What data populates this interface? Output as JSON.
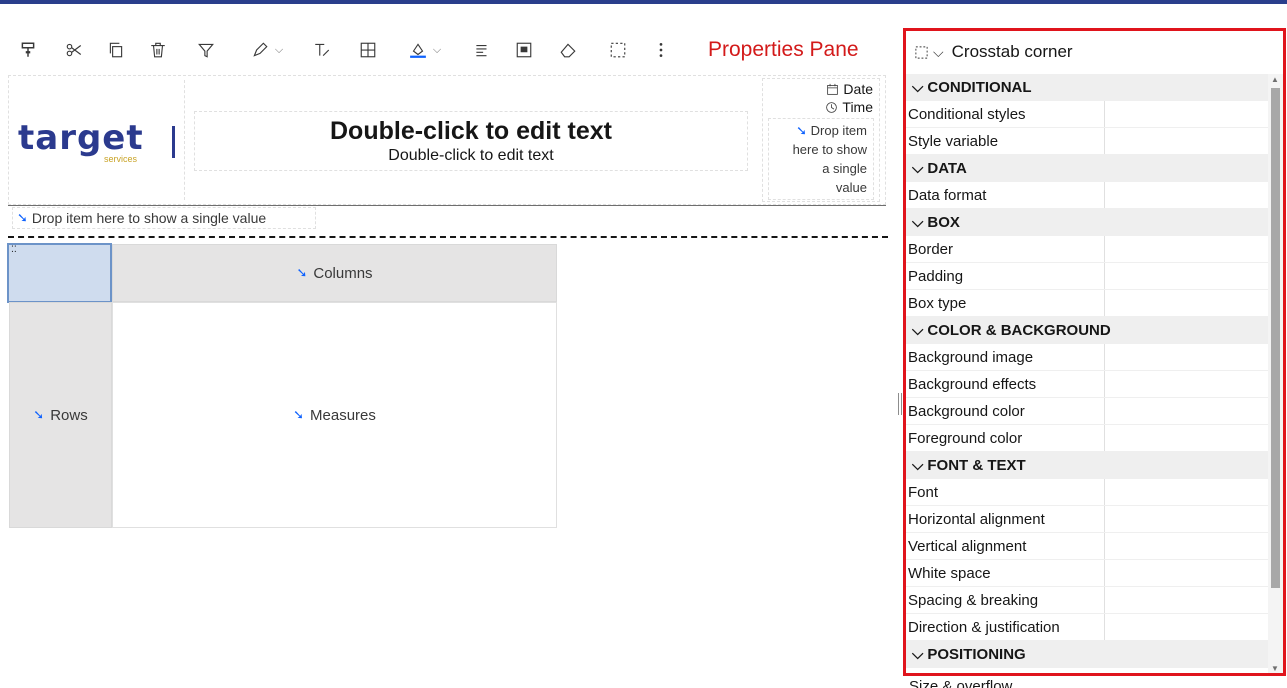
{
  "callout": {
    "label": "Properties Pane"
  },
  "toolbar": {
    "items": [
      "paint-format-icon",
      "cut-icon",
      "copy-icon",
      "delete-icon",
      "filter-icon",
      "pen-icon",
      "clear-format-icon",
      "table-icon",
      "fill-color-icon",
      "list-icon",
      "frame-icon",
      "eraser-icon",
      "select-icon",
      "more-icon"
    ]
  },
  "header": {
    "logo_text": "target",
    "logo_sub": "services",
    "title": "Double-click to edit text",
    "subtitle": "Double-click to edit text",
    "date_label": "Date",
    "time_label": "Time",
    "drop_right": [
      "Drop item",
      "here to show",
      "a single",
      "value"
    ],
    "drop_bar": "Drop item here to show a single value"
  },
  "crosstab": {
    "columns": "Columns",
    "rows": "Rows",
    "measures": "Measures"
  },
  "pane": {
    "title": "Crosstab corner",
    "sections": [
      {
        "name": "CONDITIONAL",
        "rows": [
          "Conditional styles",
          "Style variable"
        ]
      },
      {
        "name": "DATA",
        "rows": [
          "Data format"
        ]
      },
      {
        "name": "BOX",
        "rows": [
          "Border",
          "Padding",
          "Box type"
        ]
      },
      {
        "name": "COLOR & BACKGROUND",
        "rows": [
          "Background image",
          "Background effects",
          "Background color",
          "Foreground color"
        ]
      },
      {
        "name": "FONT & TEXT",
        "rows": [
          "Font",
          "Horizontal alignment",
          "Vertical alignment",
          "White space",
          "Spacing & breaking",
          "Direction & justification"
        ]
      },
      {
        "name": "POSITIONING",
        "rows": []
      }
    ],
    "cut_row": "Size & overflow"
  },
  "colors": {
    "accent": "#0f62fe",
    "callout": "#e0141c",
    "selected_cell": "#cfdcee",
    "logo": "#2b3a8e"
  }
}
